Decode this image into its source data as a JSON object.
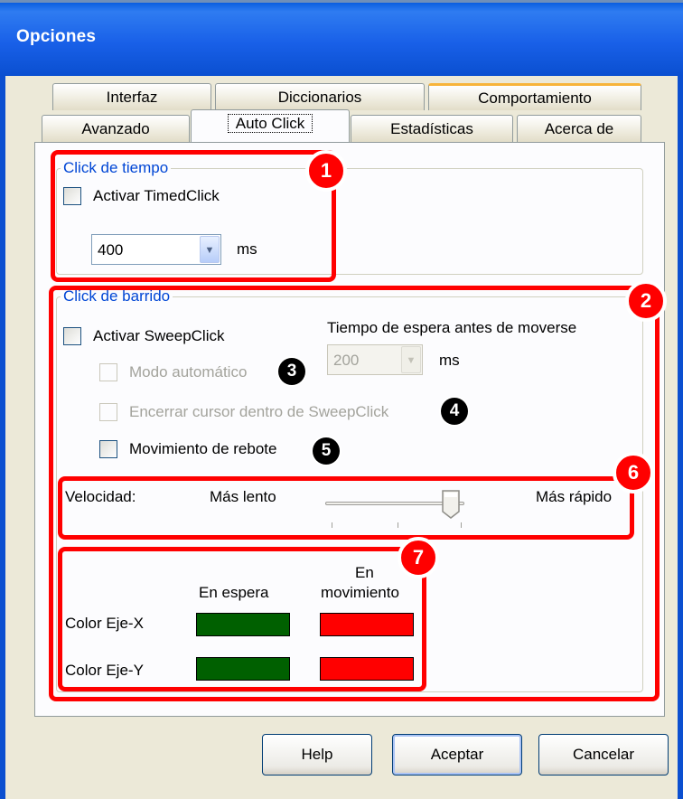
{
  "window": {
    "title": "Opciones"
  },
  "tabs": {
    "row1": [
      "Interfaz",
      "Diccionarios",
      "Comportamiento"
    ],
    "row2": [
      "Avanzado",
      "Auto Click",
      "Estadísticas",
      "Acerca de"
    ],
    "active": "Auto Click"
  },
  "timed_click": {
    "legend": "Click de tiempo",
    "enable_label": "Activar TimedClick",
    "enable_checked": false,
    "interval_value": "400",
    "interval_unit": "ms"
  },
  "sweep_click": {
    "legend": "Click de barrido",
    "enable_label": "Activar SweepClick",
    "enable_checked": false,
    "wait_label": "Tiempo de espera antes de moverse",
    "wait_value": "200",
    "wait_unit": "ms",
    "auto_mode_label": "Modo automático",
    "confine_cursor_label": "Encerrar cursor dentro de SweepClick",
    "bounce_label": "Movimiento de rebote",
    "speed": {
      "label": "Velocidad:",
      "slow_label": "Más lento",
      "fast_label": "Más rápido",
      "level": 0.9
    },
    "colors": {
      "waiting_header": "En espera",
      "moving_header_line1": "En",
      "moving_header_line2": "movimiento",
      "x_axis_label": "Color Eje-X",
      "y_axis_label": "Color Eje-Y",
      "waiting_color": "#006000",
      "moving_color": "#ff0000"
    }
  },
  "annotations": [
    "1",
    "2",
    "3",
    "4",
    "5",
    "6",
    "7"
  ],
  "buttons": {
    "help": "Help",
    "ok": "Aceptar",
    "cancel": "Cancelar"
  }
}
